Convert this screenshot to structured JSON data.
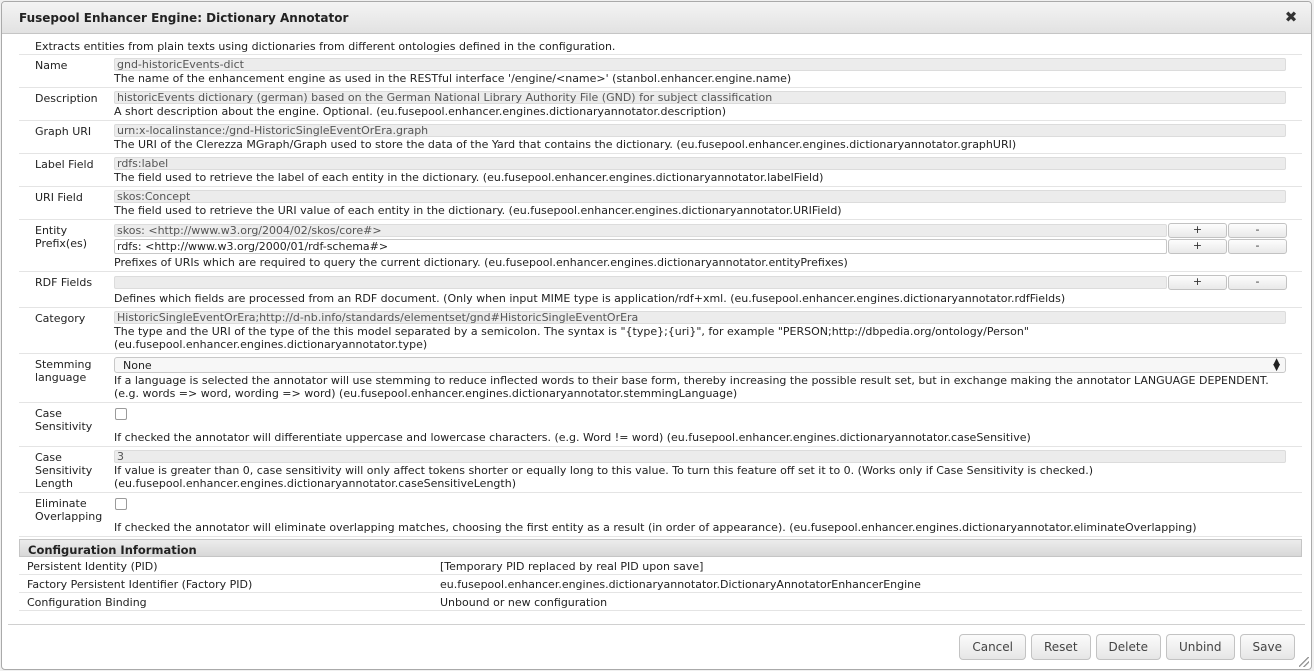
{
  "dialog": {
    "title": "Fusepool Enhancer Engine: Dictionary Annotator",
    "close_icon": "✖"
  },
  "intro": "Extracts entities from plain texts using dictionaries from different ontologies defined in the configuration.",
  "fields": {
    "name": {
      "label": "Name",
      "value": "gnd-historicEvents-dict",
      "desc": "The name of the enhancement engine as used in the RESTful interface '/engine/<name>' (stanbol.enhancer.engine.name)"
    },
    "description": {
      "label": "Description",
      "value": "historicEvents dictionary (german) based on the German National Library Authority File (GND) for subject classification",
      "desc": "A short description about the engine. Optional. (eu.fusepool.enhancer.engines.dictionaryannotator.description)"
    },
    "graph_uri": {
      "label": "Graph URI",
      "value": "urn:x-localinstance:/gnd-HistoricSingleEventOrEra.graph",
      "desc": "The URI of the Clerezza MGraph/Graph used to store the data of the Yard that contains the dictionary. (eu.fusepool.enhancer.engines.dictionaryannotator.graphURI)"
    },
    "label_field": {
      "label": "Label Field",
      "value": "rdfs:label",
      "desc": "The field used to retrieve the label of each entity in the dictionary. (eu.fusepool.enhancer.engines.dictionaryannotator.labelField)"
    },
    "uri_field": {
      "label": "URI Field",
      "value": "skos:Concept",
      "desc": "The field used to retrieve the URI value of each entity in the dictionary. (eu.fusepool.enhancer.engines.dictionaryannotator.URIField)"
    },
    "entity_prefixes": {
      "label": "Entity Prefix(es)",
      "values": [
        "skos: <http://www.w3.org/2004/02/skos/core#>",
        "rdfs: <http://www.w3.org/2000/01/rdf-schema#>"
      ],
      "plus": "+",
      "minus": "-",
      "desc": "Prefixes of URIs which are required to query the current dictionary. (eu.fusepool.enhancer.engines.dictionaryannotator.entityPrefixes)"
    },
    "rdf_fields": {
      "label": "RDF Fields",
      "value": "",
      "plus": "+",
      "minus": "-",
      "desc": "Defines which fields are processed from an RDF document. (Only when input MIME type is application/rdf+xml. (eu.fusepool.enhancer.engines.dictionaryannotator.rdfFields)"
    },
    "category": {
      "label": "Category",
      "value": "HistoricSingleEventOrEra;http://d-nb.info/standards/elementset/gnd#HistoricSingleEventOrEra",
      "desc": "The type and the URI of the type of the this model separated by a semicolon. The syntax is \"{type};{uri}\", for example \"PERSON;http://dbpedia.org/ontology/Person\" (eu.fusepool.enhancer.engines.dictionaryannotator.type)"
    },
    "stemming": {
      "label": "Stemming language",
      "value": "None",
      "desc": "If a language is selected the annotator will use stemming to reduce inflected words to their base form, thereby increasing the possible result set, but in exchange making the annotator LANGUAGE DEPENDENT. (e.g. words => word, wording => word) (eu.fusepool.enhancer.engines.dictionaryannotator.stemmingLanguage)"
    },
    "case_sensitivity": {
      "label": "Case Sensitivity",
      "checked": false,
      "desc": "If checked the annotator will differentiate uppercase and lowercase characters. (e.g. Word != word) (eu.fusepool.enhancer.engines.dictionaryannotator.caseSensitive)"
    },
    "case_length": {
      "label": "Case Sensitivity Length",
      "value": "3",
      "desc": "If value is greater than 0, case sensitivity will only affect tokens shorter or equally long to this value. To turn this feature off set it to 0. (Works only if Case Sensitivity is checked.) (eu.fusepool.enhancer.engines.dictionaryannotator.caseSensitiveLength)"
    },
    "eliminate_overlapping": {
      "label": "Eliminate Overlapping",
      "checked": false,
      "desc": "If checked the annotator will eliminate overlapping matches, choosing the first entity as a result (in order of appearance). (eu.fusepool.enhancer.engines.dictionaryannotator.eliminateOverlapping)"
    }
  },
  "config_info": {
    "header": "Configuration Information",
    "rows": [
      {
        "key": "Persistent Identity (PID)",
        "value": "[Temporary PID replaced by real PID upon save]"
      },
      {
        "key": "Factory Persistent Identifier (Factory PID)",
        "value": "eu.fusepool.enhancer.engines.dictionaryannotator.DictionaryAnnotatorEnhancerEngine"
      },
      {
        "key": "Configuration Binding",
        "value": "Unbound or new configuration"
      }
    ]
  },
  "buttons": {
    "cancel": "Cancel",
    "reset": "Reset",
    "delete": "Delete",
    "unbind": "Unbind",
    "save": "Save"
  }
}
